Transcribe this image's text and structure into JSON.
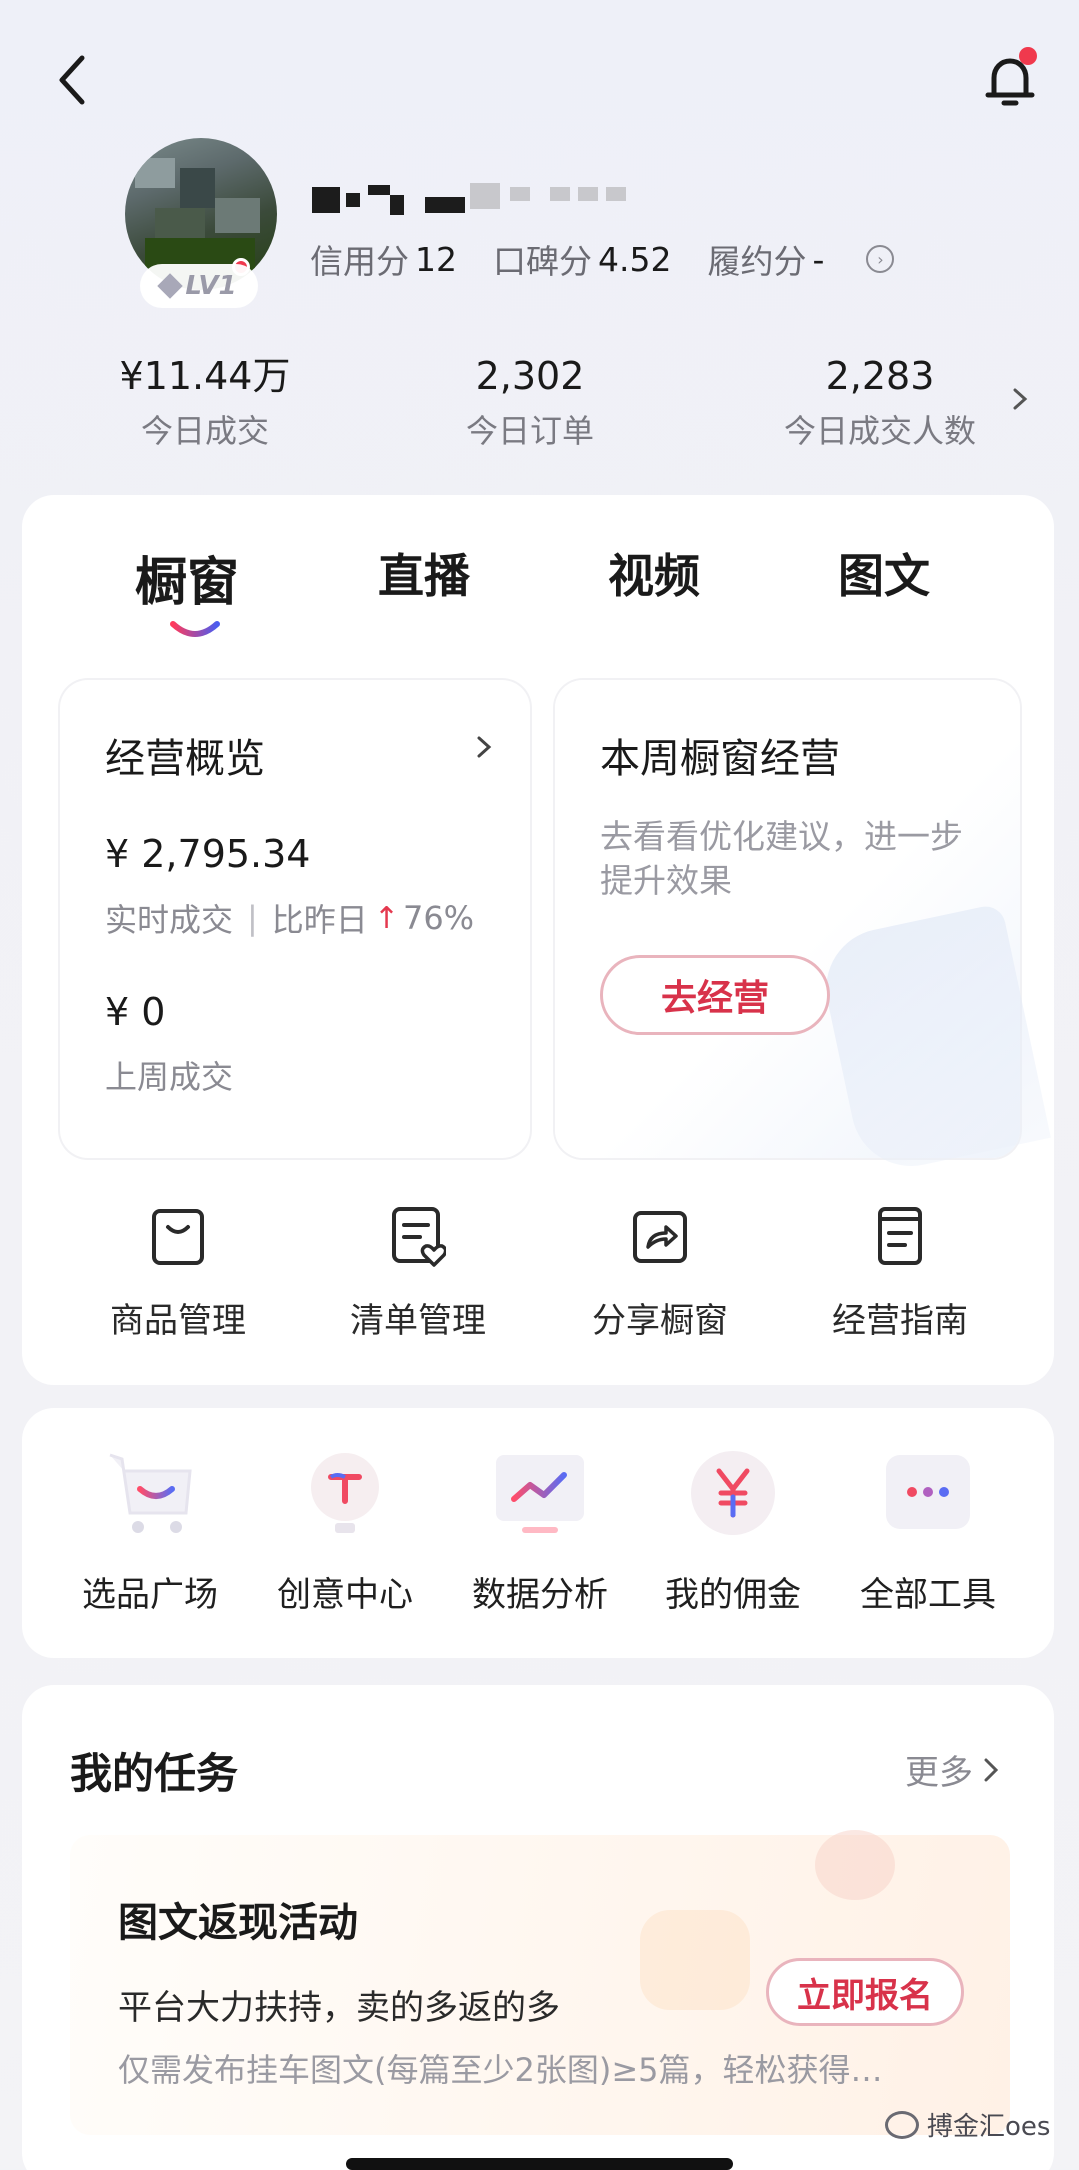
{
  "profile": {
    "level": "LV1",
    "credit_label": "信用分",
    "credit_value": "12",
    "reputation_label": "口碑分",
    "reputation_value": "4.52",
    "fulfillment_label": "履约分",
    "fulfillment_value": "-"
  },
  "stats": [
    {
      "value": "¥11.44万",
      "label": "今日成交"
    },
    {
      "value": "2,302",
      "label": "今日订单"
    },
    {
      "value": "2,283",
      "label": "今日成交人数"
    }
  ],
  "tabs": [
    "橱窗",
    "直播",
    "视频",
    "图文"
  ],
  "overview": {
    "title": "经营概览",
    "realtime_amount": "¥ 2,795.34",
    "realtime_label": "实时成交",
    "compare_label": "比昨日",
    "compare_value": "76%",
    "lastweek_amount": "¥ 0",
    "lastweek_label": "上周成交"
  },
  "weekly": {
    "title": "本周橱窗经营",
    "desc_line1": "去看看优化建议，进一步",
    "desc_line2": "提升效果",
    "button": "去经营"
  },
  "management": [
    {
      "label": "商品管理",
      "icon": "bag-icon"
    },
    {
      "label": "清单管理",
      "icon": "list-heart-icon"
    },
    {
      "label": "分享橱窗",
      "icon": "share-icon"
    },
    {
      "label": "经营指南",
      "icon": "guide-icon"
    }
  ],
  "tools": [
    {
      "label": "选品广场",
      "icon": "cart-icon"
    },
    {
      "label": "创意中心",
      "icon": "bulb-icon"
    },
    {
      "label": "数据分析",
      "icon": "chart-icon"
    },
    {
      "label": "我的佣金",
      "icon": "yuan-icon"
    },
    {
      "label": "全部工具",
      "icon": "more-icon"
    }
  ],
  "tasks": {
    "title": "我的任务",
    "more": "更多",
    "item": {
      "title": "图文返现活动",
      "desc": "平台大力扶持，卖的多返的多",
      "note": "仅需发布挂车图文(每篇至少2张图)≥5篇，轻松获得…",
      "button": "立即报名"
    }
  },
  "watermark": "搏金汇oes",
  "colors": {
    "accent": "#d8324a",
    "notification_dot": "#f0394d"
  }
}
